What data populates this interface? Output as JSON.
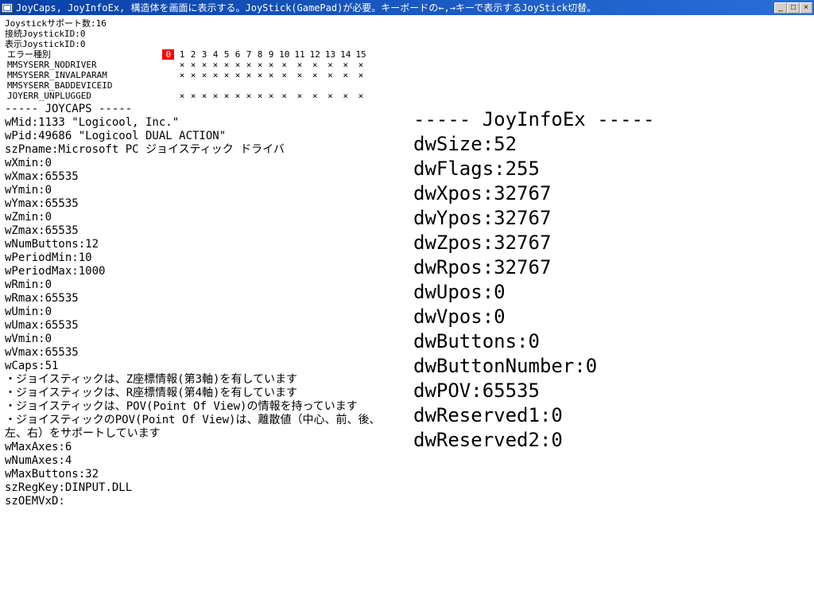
{
  "title": "JoyCaps, JoyInfoEx, 構造体を画面に表示する。JoyStick(GamePad)が必要。キーボードの←,→キーで表示するJoyStick切替。",
  "header": {
    "support": "Joystickサポート数:16",
    "conn": "接続JoystickID:0",
    "disp": "表示JoystickID:0",
    "errLabel": "エラー種別"
  },
  "errCols": [
    "0",
    "1",
    "2",
    "3",
    "4",
    "5",
    "6",
    "7",
    "8",
    "9",
    "10",
    "11",
    "12",
    "13",
    "14",
    "15"
  ],
  "errRows": [
    {
      "name": "MMSYSERR_NODRIVER",
      "mask": [
        0,
        1,
        1,
        1,
        1,
        1,
        1,
        1,
        1,
        1,
        1,
        1,
        1,
        1,
        1,
        1
      ]
    },
    {
      "name": "MMSYSERR_INVALPARAM",
      "mask": [
        0,
        1,
        1,
        1,
        1,
        1,
        1,
        1,
        1,
        1,
        1,
        1,
        1,
        1,
        1,
        1
      ]
    },
    {
      "name": "MMSYSERR_BADDEVICEID",
      "mask": [
        0,
        0,
        0,
        0,
        0,
        0,
        0,
        0,
        0,
        0,
        0,
        0,
        0,
        0,
        0,
        0
      ]
    },
    {
      "name": "JOYERR_UNPLUGGED",
      "mask": [
        0,
        1,
        1,
        1,
        1,
        1,
        1,
        1,
        1,
        1,
        1,
        1,
        1,
        1,
        1,
        1
      ]
    }
  ],
  "joycaps": {
    "header": "----- JOYCAPS -----",
    "wMid": "wMid:1133 \"Logicool, Inc.\"",
    "wPid": "wPid:49686 \"Logicool DUAL ACTION\"",
    "szPname": "szPname:Microsoft PC ジョイスティック ドライバ",
    "wXmin": "wXmin:0",
    "wXmax": "wXmax:65535",
    "wYmin": "wYmin:0",
    "wYmax": "wYmax:65535",
    "wZmin": "wZmin:0",
    "wZmax": "wZmax:65535",
    "wNumButtons": "wNumButtons:12",
    "wPeriodMin": "wPeriodMin:10",
    "wPeriodMax": "wPeriodMax:1000",
    "wRmin": "wRmin:0",
    "wRmax": "wRmax:65535",
    "wUmin": "wUmin:0",
    "wUmax": "wUmax:65535",
    "wVmin": "wVmin:0",
    "wVmax": "wVmax:65535",
    "wCaps": "wCaps:51",
    "b1": "・ジョイスティックは、Z座標情報(第3軸)を有しています",
    "b2": "・ジョイスティックは、R座標情報(第4軸)を有しています",
    "b3": "・ジョイスティックは、POV(Point Of View)の情報を持っています",
    "b4": "・ジョイスティックのPOV(Point Of View)は、離散値（中心、前、後、左、右）をサポートしています",
    "wMaxAxes": "wMaxAxes:6",
    "wNumAxes": "wNumAxes:4",
    "wMaxButtons": "wMaxButtons:32",
    "szRegKey": "szRegKey:DINPUT.DLL",
    "szOEMVxD": "szOEMVxD:"
  },
  "joyinfo": {
    "header": "----- JoyInfoEx -----",
    "dwSize": "dwSize:52",
    "dwFlags": "dwFlags:255",
    "dwXpos": "dwXpos:32767",
    "dwYpos": "dwYpos:32767",
    "dwZpos": "dwZpos:32767",
    "dwRpos": "dwRpos:32767",
    "dwUpos": "dwUpos:0",
    "dwVpos": "dwVpos:0",
    "dwButtons": "dwButtons:0",
    "dwButtonNumber": "dwButtonNumber:0",
    "dwPOV": "dwPOV:65535",
    "dwReserved1": "dwReserved1:0",
    "dwReserved2": "dwReserved2:0"
  }
}
